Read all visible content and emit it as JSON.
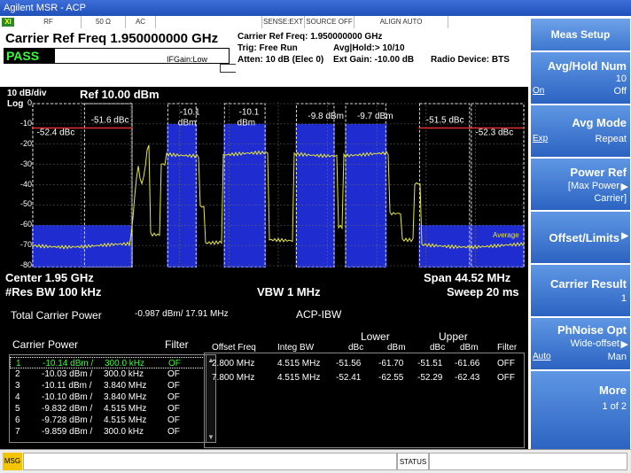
{
  "window": {
    "title": "Agilent MSR - ACP"
  },
  "toolbar": {
    "cells": [
      "RF",
      "50 Ω",
      "AC",
      "SENSE:EXT",
      "SOURCE OFF",
      "ALIGN AUTO"
    ],
    "xi_badge": "XI"
  },
  "header": {
    "carrier_ref_freq": "Carrier Ref Freq 1.950000000 GHz",
    "verdict": "PASS",
    "if_gain": "IFGain:Low",
    "carrier_ref_small": "Carrier Ref Freq: 1.950000000 GHz",
    "trig": "Trig: Free Run",
    "avg_hold": "Avg|Hold:> 10/10",
    "atten": "Atten: 10 dB (Elec 0)",
    "ext_gain": "Ext Gain: -10.00 dB",
    "radio_device": "Radio Device: BTS"
  },
  "plot": {
    "scale_div": "10 dB/div",
    "ref_level": "Ref 10.00 dBm",
    "log_label": "Log",
    "y_ticks": [
      "0",
      "-10",
      "-20",
      "-30",
      "-40",
      "-50",
      "-60",
      "-70",
      "-80"
    ],
    "box_labels": [
      "-52.4 dBc",
      "-51.6 dBc",
      "-10.1 dBm",
      "-10.1 dBm",
      "-9.8 dBm",
      "-9.7 dBm",
      "-51.5 dBc",
      "-52.3 dBc"
    ],
    "average_label": "Average",
    "center": "Center  1.95 GHz",
    "res_bw": "#Res BW  100 kHz",
    "vbw": "VBW  1 MHz",
    "span": "Span 44.52 MHz",
    "sweep": "Sweep  20 ms",
    "colors": {
      "bg": "#000000",
      "band": "#1f2cd0",
      "trace": "#e8e83a",
      "limit": "#e03030",
      "grid": "#6a6a6a"
    }
  },
  "results": {
    "total_carrier_power_label": "Total Carrier Power",
    "total_carrier_power_value": "-0.987 dBm/ 17.91 MHz",
    "mode": "ACP-IBW",
    "carrier_power_label": "Carrier Power",
    "filter_label": "Filter",
    "carriers": [
      {
        "n": "1",
        "p": "-10.14 dBm /",
        "bw": "300.0 kHz",
        "f": "OF"
      },
      {
        "n": "2",
        "p": "-10.03 dBm /",
        "bw": "300.0 kHz",
        "f": "OF"
      },
      {
        "n": "3",
        "p": "-10.11 dBm /",
        "bw": "3.840 MHz",
        "f": "OF"
      },
      {
        "n": "4",
        "p": "-10.10 dBm /",
        "bw": "3.840 MHz",
        "f": "OF"
      },
      {
        "n": "5",
        "p": "-9.832 dBm /",
        "bw": "4.515 MHz",
        "f": "OF"
      },
      {
        "n": "6",
        "p": "-9.728 dBm /",
        "bw": "4.515 MHz",
        "f": "OF"
      },
      {
        "n": "7",
        "p": "-9.859 dBm /",
        "bw": "300.0 kHz",
        "f": "OF"
      }
    ],
    "offset_headers": {
      "lower": "Lower",
      "upper": "Upper",
      "offset_freq": "Offset Freq",
      "integ_bw": "Integ BW",
      "dbc_l": "dBc",
      "dbm_l": "dBm",
      "dbc_u": "dBc",
      "dbm_u": "dBm",
      "filter": "Filter"
    },
    "offsets": [
      {
        "freq": "2.800 MHz",
        "bw": "4.515 MHz",
        "ldbc": "-51.56",
        "ldbm": "-61.70",
        "udbc": "-51.51",
        "udbm": "-61.66",
        "filter": "OFF"
      },
      {
        "freq": "7.800 MHz",
        "bw": "4.515 MHz",
        "ldbc": "-52.41",
        "ldbm": "-62.55",
        "udbc": "-52.29",
        "udbm": "-62.43",
        "filter": "OFF"
      }
    ]
  },
  "status": {
    "msg": "MSG",
    "status": "STATUS"
  },
  "softkeys": {
    "title": "Meas Setup",
    "avg_hold": {
      "title": "Avg/Hold Num",
      "value": "10",
      "on": "On",
      "off": "Off"
    },
    "avg_mode": {
      "title": "Avg Mode",
      "left": "Exp",
      "right": "Repeat"
    },
    "power_ref": {
      "title": "Power Ref",
      "line1": "[Max Power",
      "line2": "Carrier]",
      "arrow": "▶"
    },
    "offset_limits": {
      "title": "Offset/Limits",
      "arrow": "▶"
    },
    "carrier_result": {
      "title": "Carrier Result",
      "value": "1"
    },
    "phnoise": {
      "title": "PhNoise Opt",
      "line1": "Wide-offset",
      "left": "Auto",
      "right": "Man",
      "arrow": "▶"
    },
    "more": {
      "title": "More",
      "line1": "1 of 2"
    }
  }
}
